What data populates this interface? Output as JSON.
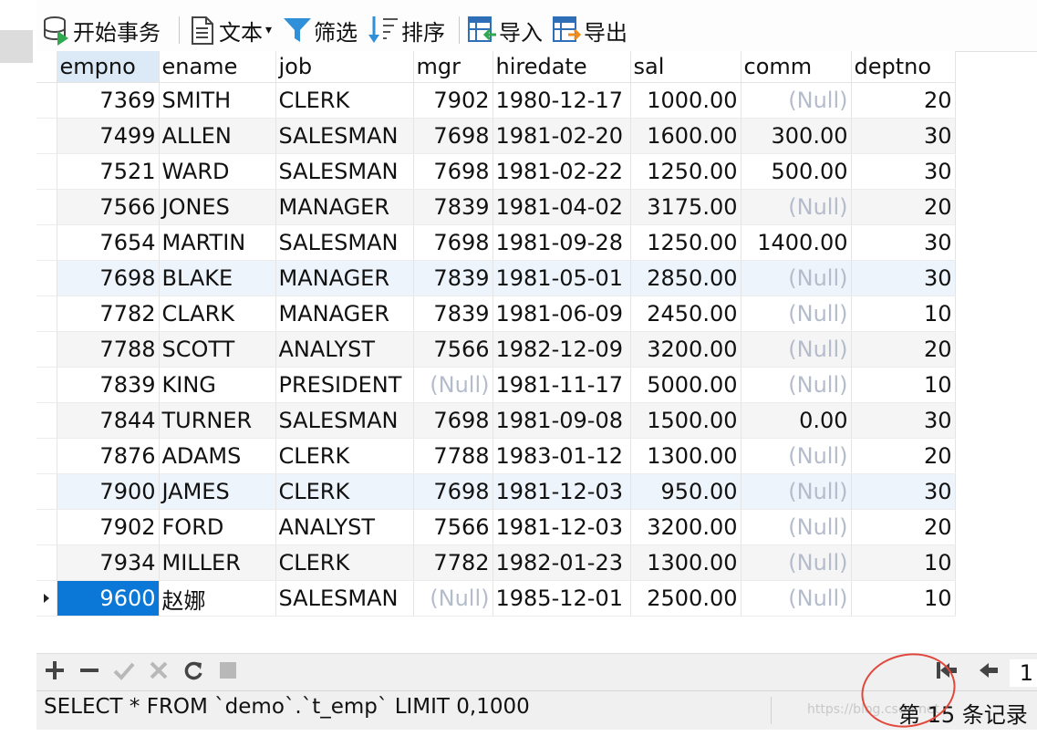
{
  "toolbar": {
    "begin_transaction": "开始事务",
    "text": "文本",
    "filter": "筛选",
    "sort": "排序",
    "import": "导入",
    "export": "导出"
  },
  "grid": {
    "columns": [
      "empno",
      "ename",
      "job",
      "mgr",
      "hiredate",
      "sal",
      "comm",
      "deptno"
    ],
    "rows": [
      [
        "7369",
        "SMITH",
        "CLERK",
        "7902",
        "1980-12-17",
        "1000.00",
        "(Null)",
        "20"
      ],
      [
        "7499",
        "ALLEN",
        "SALESMAN",
        "7698",
        "1981-02-20",
        "1600.00",
        "300.00",
        "30"
      ],
      [
        "7521",
        "WARD",
        "SALESMAN",
        "7698",
        "1981-02-22",
        "1250.00",
        "500.00",
        "30"
      ],
      [
        "7566",
        "JONES",
        "MANAGER",
        "7839",
        "1981-04-02",
        "3175.00",
        "(Null)",
        "20"
      ],
      [
        "7654",
        "MARTIN",
        "SALESMAN",
        "7698",
        "1981-09-28",
        "1250.00",
        "1400.00",
        "30"
      ],
      [
        "7698",
        "BLAKE",
        "MANAGER",
        "7839",
        "1981-05-01",
        "2850.00",
        "(Null)",
        "30"
      ],
      [
        "7782",
        "CLARK",
        "MANAGER",
        "7839",
        "1981-06-09",
        "2450.00",
        "(Null)",
        "10"
      ],
      [
        "7788",
        "SCOTT",
        "ANALYST",
        "7566",
        "1982-12-09",
        "3200.00",
        "(Null)",
        "20"
      ],
      [
        "7839",
        "KING",
        "PRESIDENT",
        "(Null)",
        "1981-11-17",
        "5000.00",
        "(Null)",
        "10"
      ],
      [
        "7844",
        "TURNER",
        "SALESMAN",
        "7698",
        "1981-09-08",
        "1500.00",
        "0.00",
        "30"
      ],
      [
        "7876",
        "ADAMS",
        "CLERK",
        "7788",
        "1983-01-12",
        "1300.00",
        "(Null)",
        "20"
      ],
      [
        "7900",
        "JAMES",
        "CLERK",
        "7698",
        "1981-12-03",
        "950.00",
        "(Null)",
        "30"
      ],
      [
        "7902",
        "FORD",
        "ANALYST",
        "7566",
        "1981-12-03",
        "3200.00",
        "(Null)",
        "20"
      ],
      [
        "7934",
        "MILLER",
        "CLERK",
        "7782",
        "1982-01-23",
        "1300.00",
        "(Null)",
        "10"
      ],
      [
        "9600",
        "赵娜",
        "SALESMAN",
        "(Null)",
        "1985-12-01",
        "2500.00",
        "(Null)",
        "10"
      ]
    ],
    "selected_row": 14,
    "selected_col": 0
  },
  "nav": {
    "page": "1"
  },
  "status": {
    "sql": "SELECT * FROM `demo`.`t_emp` LIMIT 0,1000",
    "records": "第 15 条记录",
    "watermark": "https://blog.csdn.net"
  },
  "colors": {
    "selection": "#0b78d7",
    "null_text": "#b4bccb",
    "annotation_circle": "#e2473d"
  },
  "icons": [
    "transaction-icon",
    "text-icon",
    "filter-icon",
    "sort-icon",
    "import-icon",
    "export-icon",
    "add-icon",
    "remove-icon",
    "apply-icon",
    "discard-icon",
    "refresh-icon",
    "stop-icon",
    "first-page-icon",
    "prev-page-icon"
  ]
}
